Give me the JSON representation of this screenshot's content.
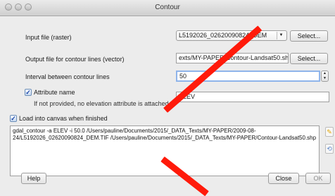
{
  "window": {
    "title": "Contour"
  },
  "form": {
    "input_label": "Input file (raster)",
    "input_value": "L5192026_02620090824_DEM",
    "input_select": "Select...",
    "output_label": "Output file for contour lines (vector)",
    "output_value": "exts/MY-PAPER/Contour-Landsat50.shp",
    "output_select": "Select...",
    "interval_label": "Interval between contour lines",
    "interval_value": "50",
    "attribute_label": "Attribute name",
    "attribute_value": "ELEV",
    "attribute_note": "If not provided, no elevation attribute is attached.",
    "load_label": "Load into canvas when finished",
    "command": "gdal_contour -a ELEV -i 50.0 /Users/pauline/Documents/2015/_DATA_Texts/MY-PAPER/2009-08-24/L5192026_02620090824_DEM.TIF /Users/pauline/Documents/2015/_DATA_Texts/MY-PAPER/Contour-Landsat50.shp"
  },
  "buttons": {
    "help": "Help",
    "close": "Close",
    "ok": "OK"
  },
  "icons": {
    "dropdown": "dropdown-arrow-icon",
    "spinner": "spin-arrows-icon",
    "edit": "pencil-edit-icon",
    "reset": "reset-icon"
  },
  "colors": {
    "accent": "#1c47a8",
    "annotation": "#ff1a0a"
  }
}
